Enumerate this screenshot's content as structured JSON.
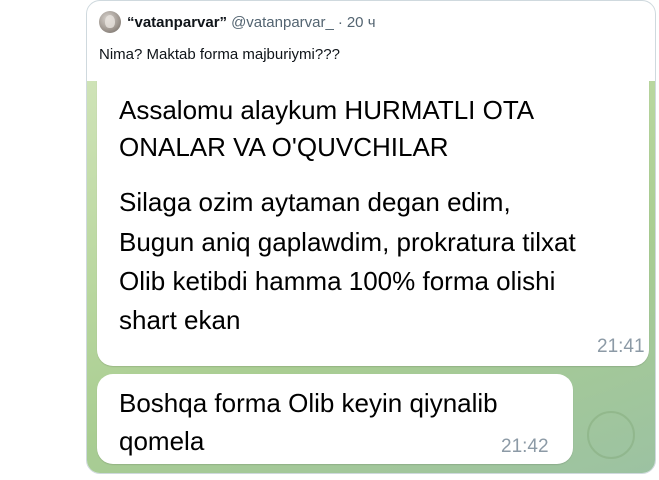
{
  "tweet": {
    "display_name": "“vatanparvar”",
    "handle": "@vatanparvar_",
    "separator": "·",
    "time": "20 ч",
    "text": "Nima? Maktab forma majburiymi???"
  },
  "chat": {
    "messages": [
      {
        "lines": [
          "Assalomu alaykum HURMATLI OTA",
          "ONALAR VA O'QUVCHILAR",
          "",
          "Silaga ozim aytaman degan edim,",
          "Bugun aniq gaplawdim, prokratura tilxat",
          "Olib ketibdi hamma 100% forma olishi",
          "shart ekan"
        ],
        "time": "21:41"
      },
      {
        "lines": [
          "Boshqa forma Olib keyin qiynalib",
          "qomela"
        ],
        "time": "21:42"
      }
    ]
  },
  "colors": {
    "chat_background": "#b9d79f",
    "bubble": "#ffffff",
    "handle_gray": "#536471",
    "timestamp_gray": "#8c9aa6"
  }
}
